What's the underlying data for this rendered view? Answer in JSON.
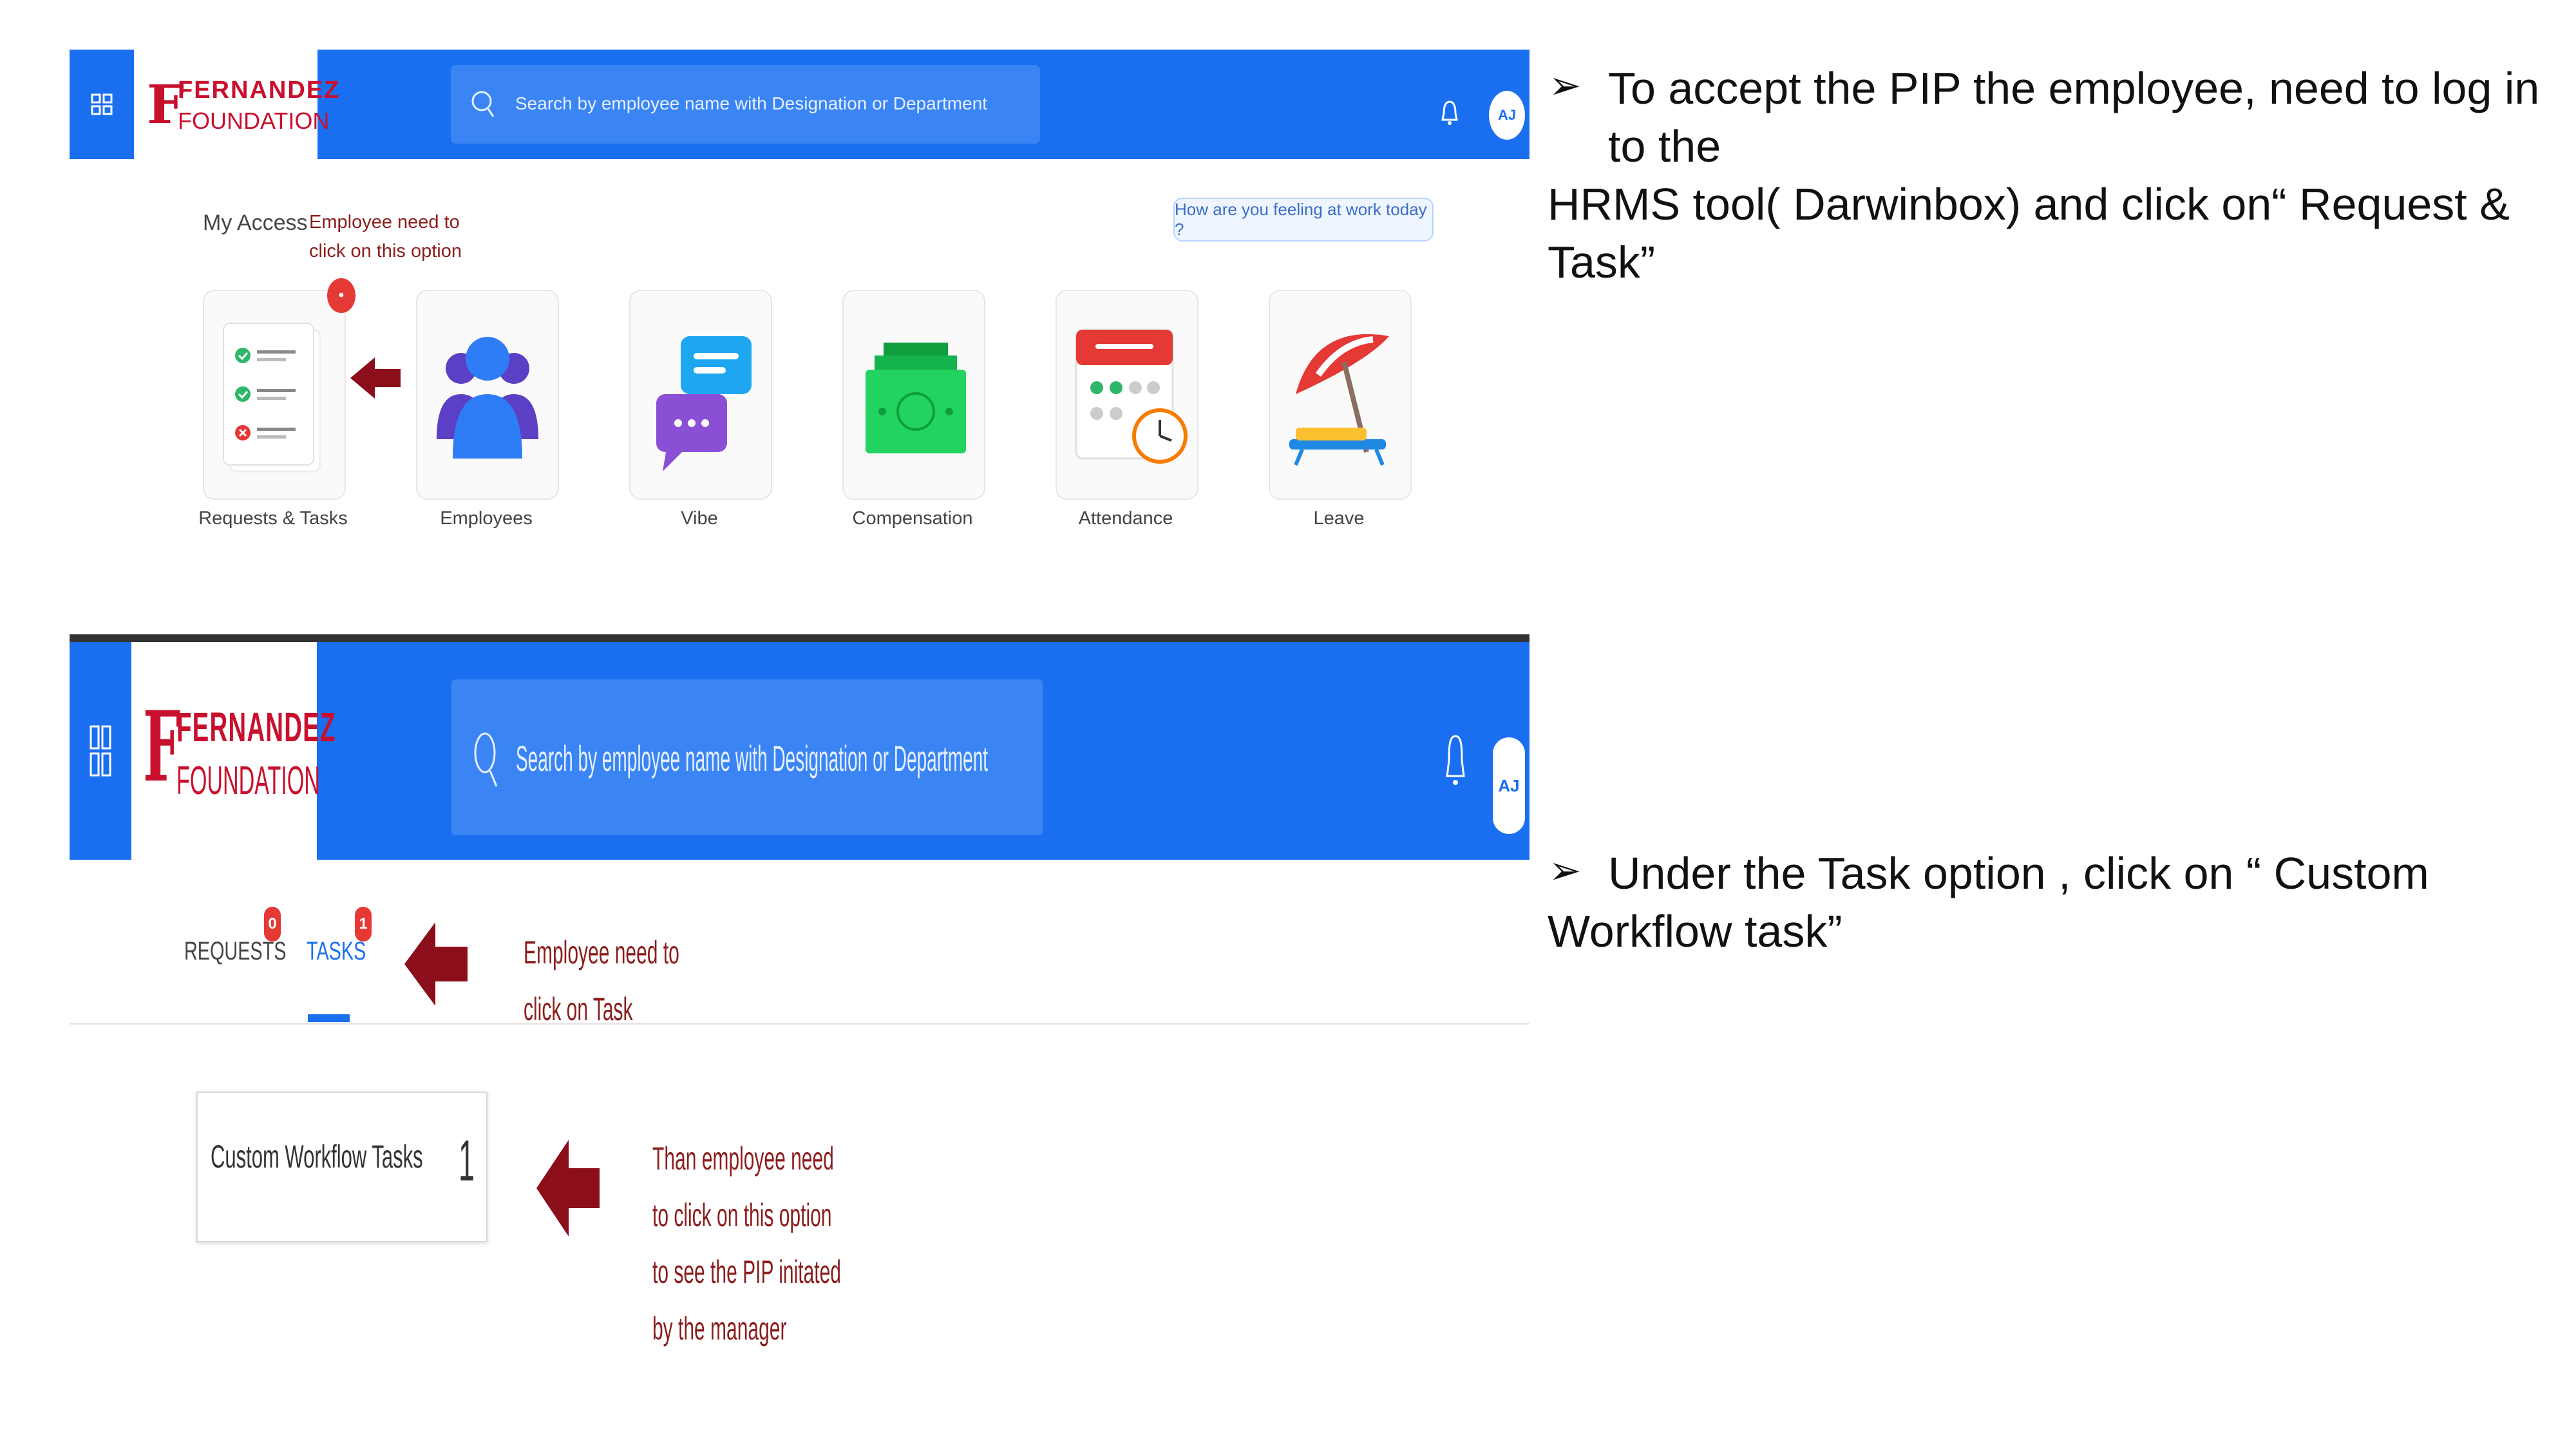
{
  "brand": {
    "logo_top": "FERNANDEZ",
    "logo_bottom": "FOUNDATION",
    "logo_initial": "F",
    "color_red": "#c8102e",
    "color_blue": "#1a6ff0"
  },
  "top_screenshot": {
    "search_placeholder": "Search by employee name with Designation or Department",
    "avatar_initials": "AJ",
    "my_access_label": "My Access",
    "employee_note_line1": "Employee need to",
    "employee_note_line2": "click on this option",
    "feeling_button": "How are you feeling at work today ?",
    "tiles": [
      {
        "label": "Requests & Tasks",
        "icon": "checklist-icon",
        "badge": "•"
      },
      {
        "label": "Employees",
        "icon": "people-icon"
      },
      {
        "label": "Vibe",
        "icon": "chat-bubbles-icon"
      },
      {
        "label": "Compensation",
        "icon": "money-icon"
      },
      {
        "label": "Attendance",
        "icon": "calendar-clock-icon"
      },
      {
        "label": "Leave",
        "icon": "beach-umbrella-icon"
      }
    ]
  },
  "bottom_screenshot": {
    "search_placeholder": "Search by employee name with Designation or Department",
    "avatar_initials": "AJ",
    "tabs": [
      {
        "label": "REQUESTS",
        "badge": "0"
      },
      {
        "label": "TASKS",
        "badge": "1"
      }
    ],
    "task_note_line1": "Employee need to",
    "task_note_line2": "click on Task",
    "card_label": "Custom Workflow Tasks",
    "card_count": "1",
    "then_note_lines": [
      "Than employee need",
      "to click on this option",
      "to see the PIP initated",
      "by the manager"
    ]
  },
  "instructions": {
    "bullet1_line1": "To accept the PIP the employee, need to log in",
    "bullet1_line2": "to the",
    "bullet1_line3": "HRMS tool( Darwinbox) and click on“ Request &",
    "bullet1_line4": "Task”",
    "bullet2_line1": "Under the Task option , click on “ Custom",
    "bullet2_line2": "Workflow task”"
  }
}
